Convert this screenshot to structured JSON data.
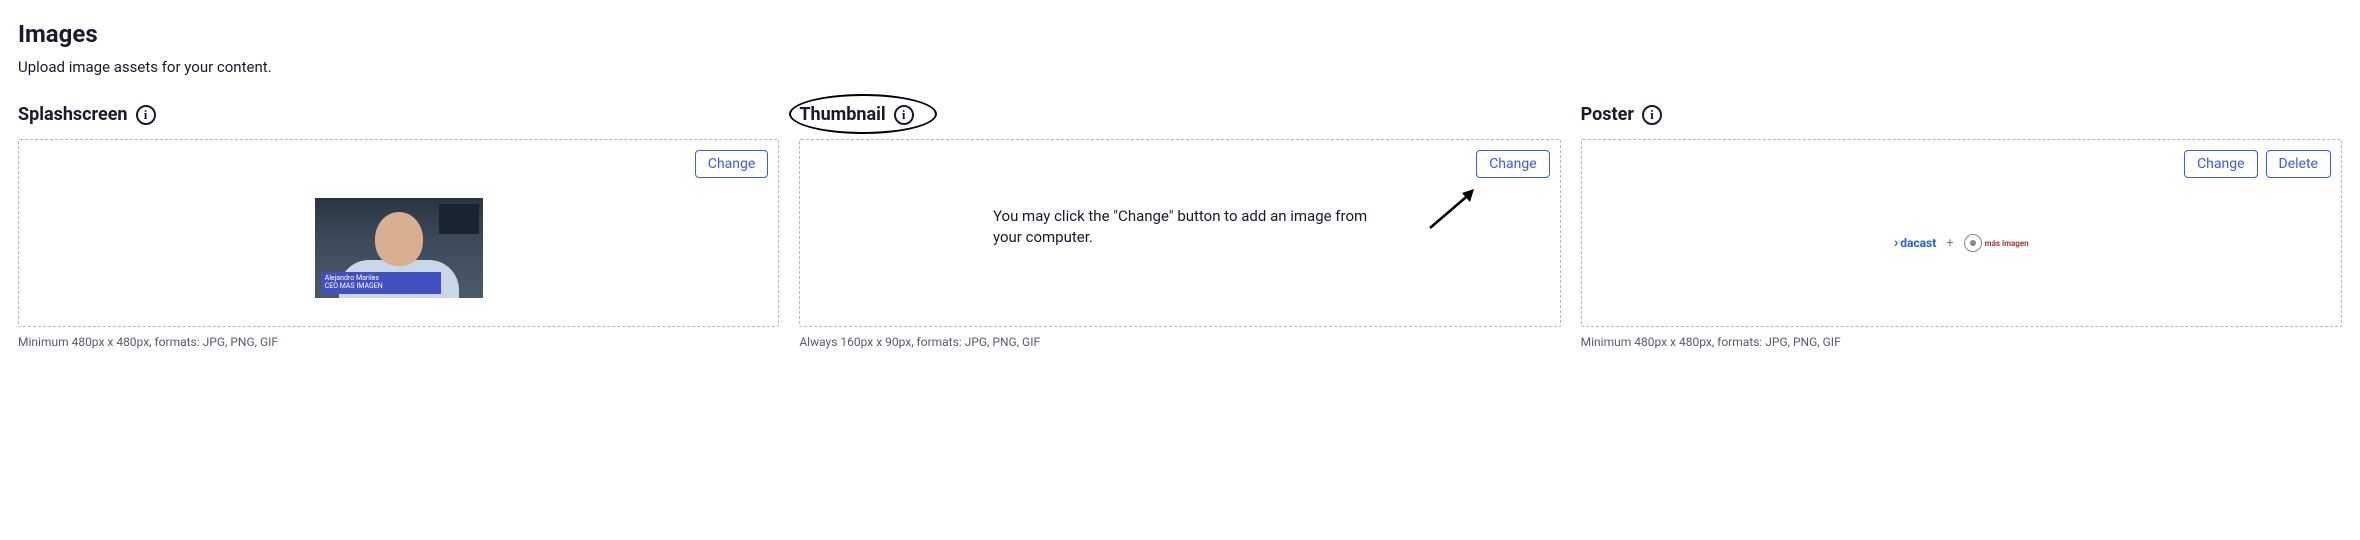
{
  "title": "Images",
  "subtitle": "Upload image assets for your content.",
  "sections": {
    "splashscreen": {
      "title": "Splashscreen",
      "change_label": "Change",
      "caption": "Minimum 480px x 480px, formats: JPG, PNG, GIF",
      "preview_name": "Alejandro Mariles",
      "preview_subtitle": "CEO MAS IMAGEN"
    },
    "thumbnail": {
      "title": "Thumbnail",
      "change_label": "Change",
      "caption": "Always 160px x 90px, formats: JPG, PNG, GIF",
      "helper_text": "You may click the \"Change\" button to add an image from your computer."
    },
    "poster": {
      "title": "Poster",
      "change_label": "Change",
      "delete_label": "Delete",
      "caption": "Minimum 480px x 480px, formats: JPG, PNG, GIF",
      "brand1": "dacast",
      "brand_sep": "+",
      "brand2": "más imagen"
    }
  },
  "info_glyph": "i"
}
